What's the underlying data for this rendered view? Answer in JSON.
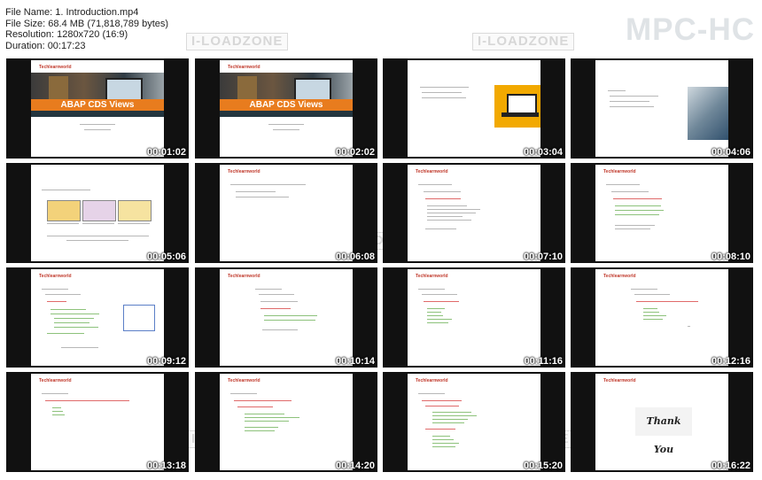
{
  "info": {
    "file_name": "File Name: 1. Introduction.mp4",
    "file_size": "File Size: 68.4 MB (71,818,789 bytes)",
    "resolution": "Resolution: 1280x720 (16:9)",
    "duration": "Duration: 00:17:23"
  },
  "logo": "MPC-HC",
  "watermark": "I-LOADZONE",
  "brand": "Techlearnworld",
  "slide_title_1": "ABAP CDS Views",
  "slide_thankyou": "Thank You",
  "timestamps": [
    "00:01:02",
    "00:02:02",
    "00:03:04",
    "00:04:06",
    "00:05:06",
    "00:06:08",
    "00:07:10",
    "00:08:10",
    "00:09:12",
    "00:10:14",
    "00:11:16",
    "00:12:16",
    "00:13:18",
    "00:14:20",
    "00:15:20",
    "00:16:22"
  ]
}
